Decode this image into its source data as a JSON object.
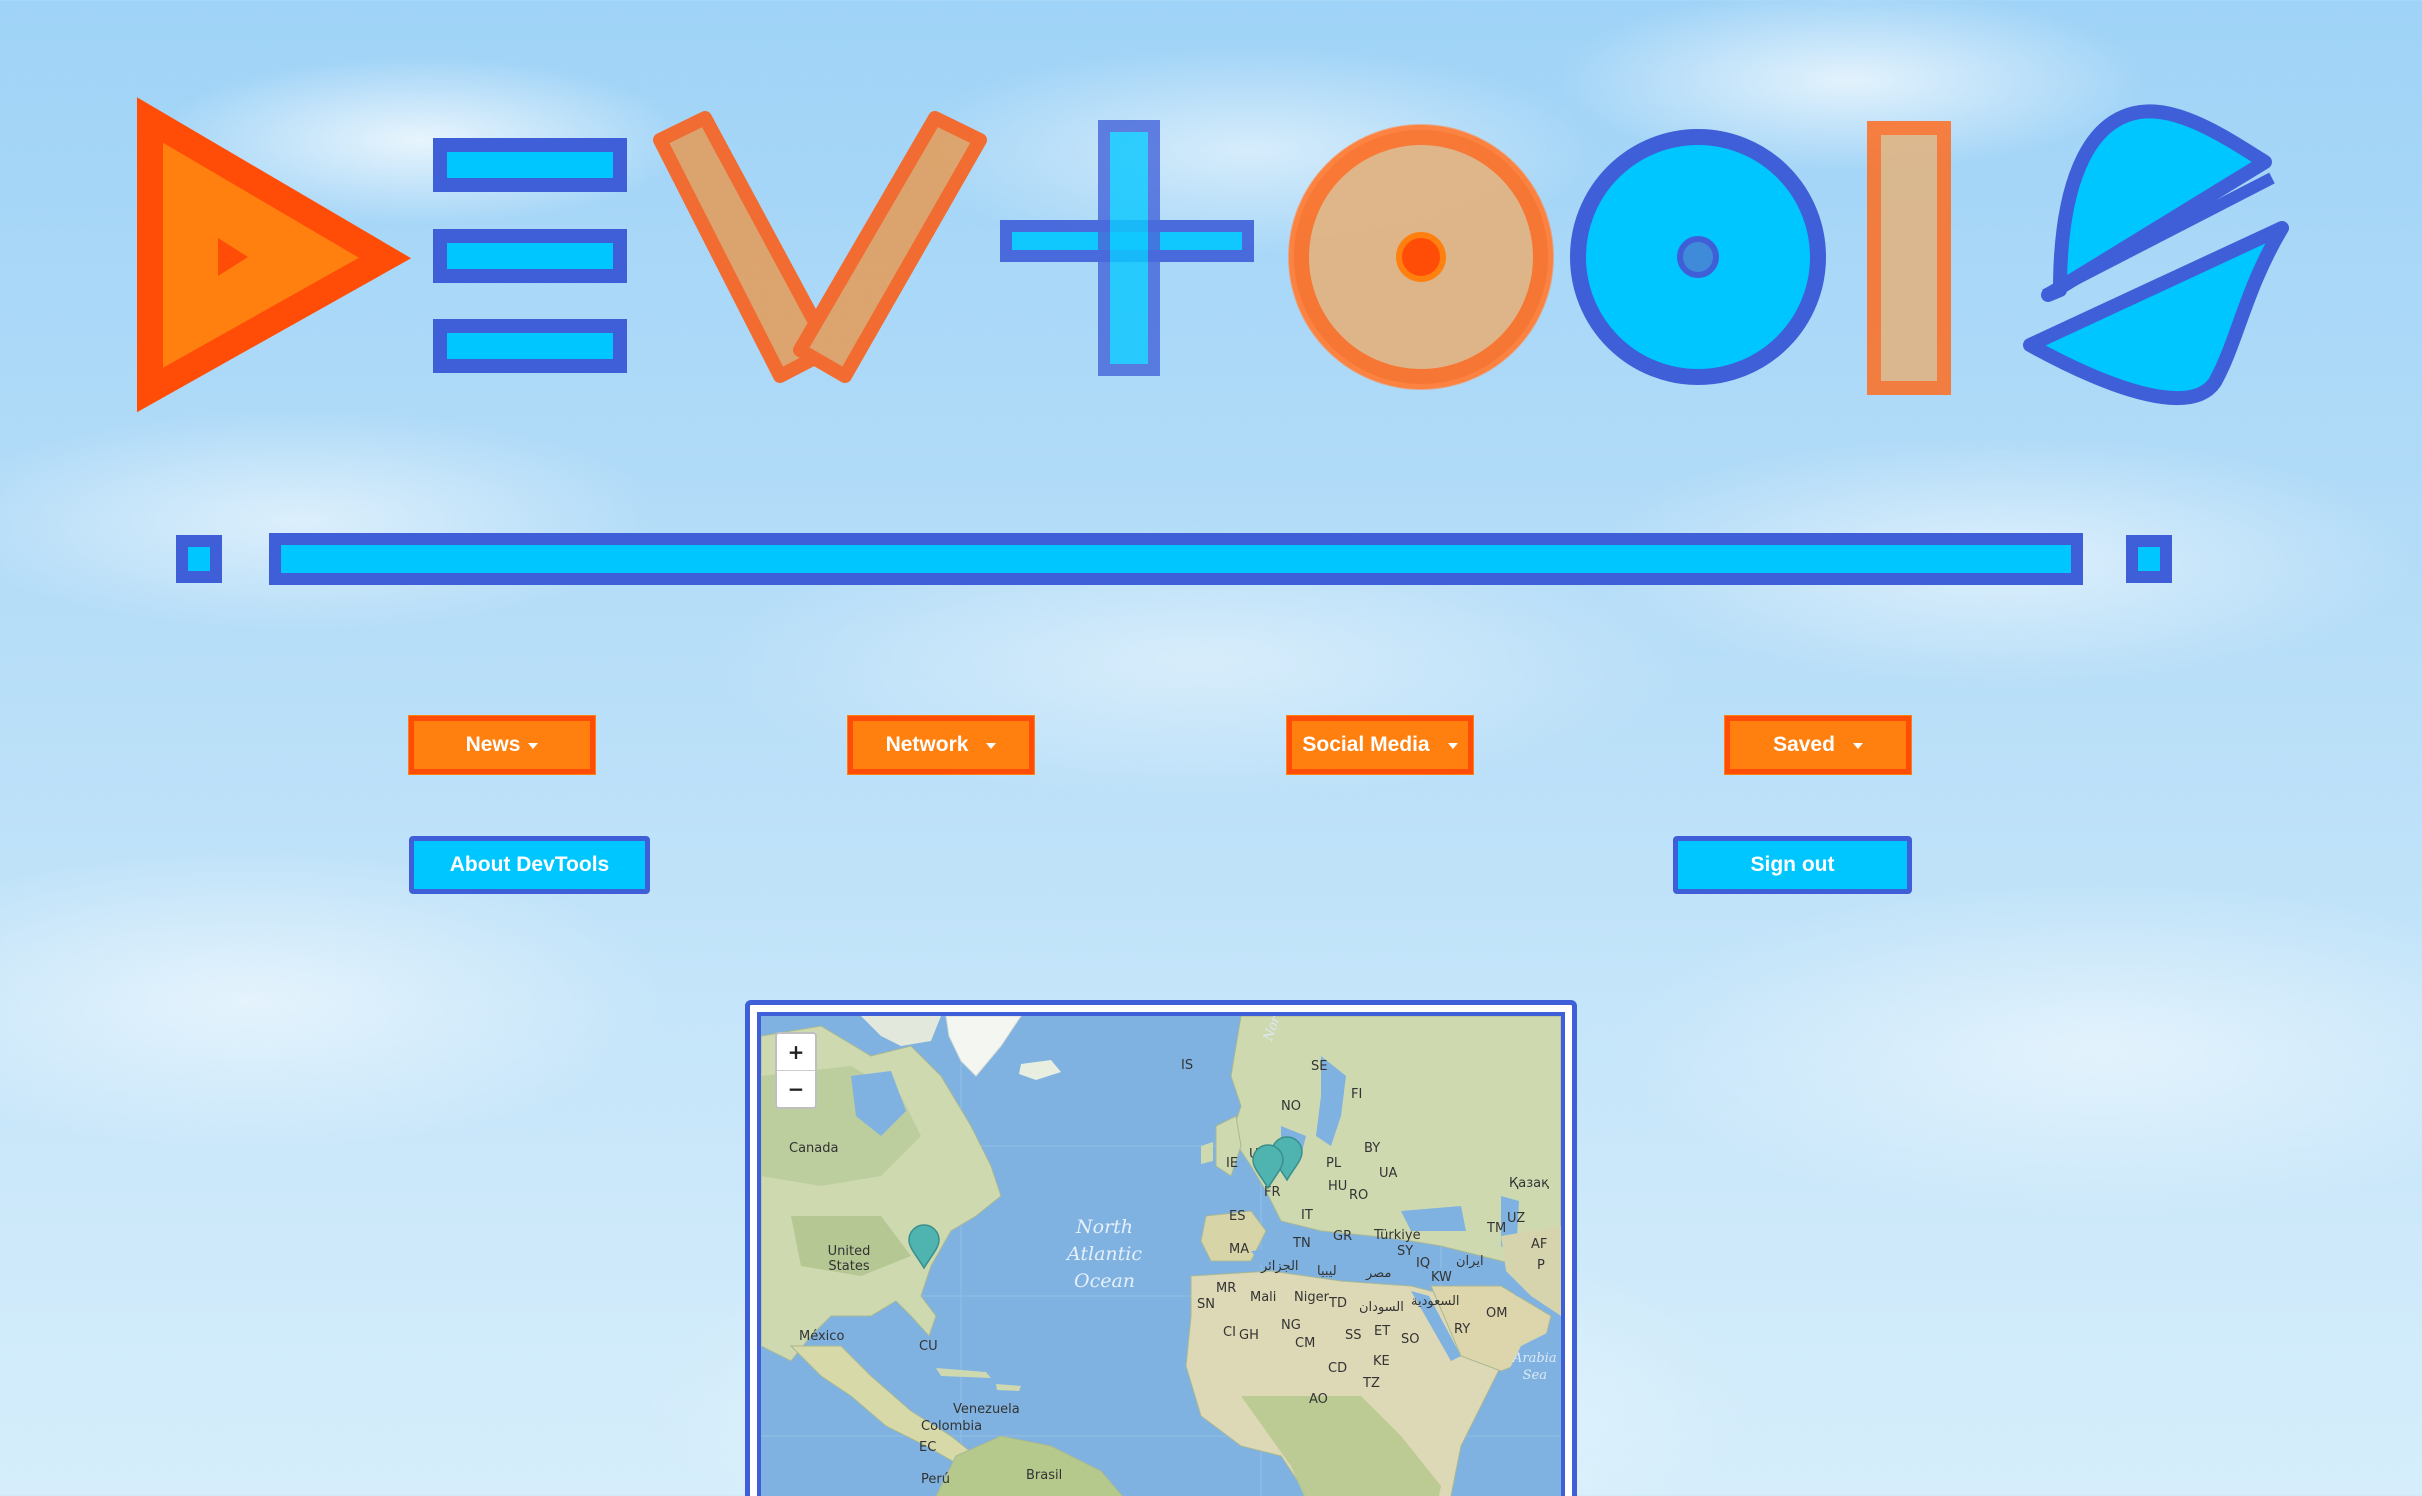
{
  "logo": {
    "text": "DEVTOOLS"
  },
  "colors": {
    "orange": "#ff7f0f",
    "orange_border": "#ff4d08",
    "blue_fill": "#00c6ff",
    "blue_border": "#3f5fd9"
  },
  "nav": {
    "news": "News",
    "network": "Network",
    "social_media": "Social Media",
    "saved": "Saved",
    "about": "About DevTools",
    "sign_out": "Sign out"
  },
  "map": {
    "zoom_in": "+",
    "zoom_out": "−",
    "labels": {
      "canada": "Canada",
      "united_states": "United States",
      "mexico": "México",
      "cuba": "CU",
      "venezuela": "Venezuela",
      "colombia": "Colombia",
      "ecuador": "EC",
      "peru": "Perú",
      "brasil": "Brasil",
      "iceland": "IS",
      "ireland": "IE",
      "uk": "UK",
      "france": "FR",
      "spain": "ES",
      "italy": "IT",
      "norway": "NO",
      "sweden": "SE",
      "finland": "FI",
      "poland": "PL",
      "belarus": "BY",
      "ukraine": "UA",
      "hungary": "HU",
      "romania": "RO",
      "greece": "GR",
      "turkey": "Türkiye",
      "syria": "SY",
      "iraq": "IQ",
      "iran": "ایران",
      "kuwait": "KW",
      "saudi": "السعودية",
      "oman": "OM",
      "yemen": "RY",
      "kazakhstan": "Қазақ",
      "uzbekistan": "UZ",
      "turkmenistan": "TM",
      "afghanistan": "AF",
      "pakistan": "P",
      "morocco": "MA",
      "tunisia": "TN",
      "algeria": "الجزائر",
      "libya": "ليبيا",
      "egypt": "مصر",
      "mauritania": "MR",
      "mali": "Mali",
      "niger": "Niger",
      "chad": "TD",
      "sudan": "السودان",
      "senegal": "SN",
      "ivory_coast": "CI",
      "ghana": "GH",
      "nigeria": "NG",
      "cameroon": "CM",
      "south_sudan": "SS",
      "ethiopia": "ET",
      "somalia": "SO",
      "kenya": "KE",
      "drc": "CD",
      "tanzania": "TZ",
      "angola": "AO",
      "norwegian_sea": "Norwegi...",
      "ocean_line1": "North",
      "ocean_line2": "Atlantic",
      "ocean_line3": "Ocean",
      "arabian_sea_1": "Arabia",
      "arabian_sea_2": "Sea"
    },
    "markers": [
      "east-coast-us",
      "france",
      "germany"
    ]
  }
}
